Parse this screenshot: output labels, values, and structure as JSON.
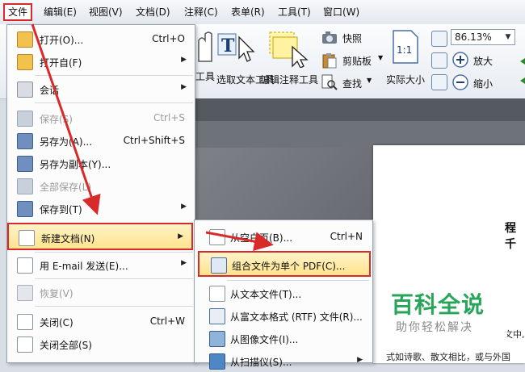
{
  "menubar": {
    "items": [
      {
        "label": "文件",
        "active": true
      },
      {
        "label": "编辑(E)"
      },
      {
        "label": "视图(V)"
      },
      {
        "label": "文档(D)"
      },
      {
        "label": "注释(C)"
      },
      {
        "label": "表单(R)"
      },
      {
        "label": "工具(T)"
      },
      {
        "label": "窗口(W)"
      }
    ]
  },
  "ribbon": {
    "tool_partial": "工具",
    "select_text_tool": "选取文本工具",
    "edit_annotation_tool": "编辑注释工具",
    "snapshot": "快照",
    "clipboard": "剪贴板",
    "find": "查找",
    "actual_size": "实际大小",
    "zoom_value": "86.13%",
    "zoom_in": "放大",
    "zoom_out": "缩小",
    "icon_actual_size_text": "1:1"
  },
  "file_menu": {
    "open": {
      "label": "打开(O)...",
      "shortcut": "Ctrl+O"
    },
    "open_from": {
      "label": "打开自(F)"
    },
    "meeting": {
      "label": "会话"
    },
    "save": {
      "label": "保存(S)",
      "shortcut": "Ctrl+S"
    },
    "save_as": {
      "label": "另存为(A)...",
      "shortcut": "Ctrl+Shift+S"
    },
    "save_copy": {
      "label": "另存为副本(Y)..."
    },
    "save_all": {
      "label": "全部保存(L)"
    },
    "save_to": {
      "label": "保存到(T)"
    },
    "new_doc": {
      "label": "新建文档(N)"
    },
    "email": {
      "label": "用 E-mail 发送(E)..."
    },
    "revert": {
      "label": "恢复(V)"
    },
    "close": {
      "label": "关闭(C)",
      "shortcut": "Ctrl+W"
    },
    "close_all": {
      "label": "关闭全部(S)"
    }
  },
  "new_submenu": {
    "blank": {
      "label": "从空白页(B)...",
      "shortcut": "Ctrl+N"
    },
    "combine": {
      "label": "组合文件为单个 PDF(C)..."
    },
    "from_text": {
      "label": "从文本文件(T)..."
    },
    "from_rtf": {
      "label": "从富文本格式 (RTF) 文件(R)..."
    },
    "from_image": {
      "label": "从图像文件(I)..."
    },
    "from_scanner": {
      "label": "从扫描仪(S)..."
    }
  },
  "document": {
    "title_fragment": "程千",
    "text_fragment1": "文中,",
    "text_fragment2": "式如诗歌、散文相比，或与外国"
  },
  "watermark": {
    "title": "百科全说",
    "subtitle": "助你轻松解决"
  },
  "colors": {
    "highlight_border": "#d82a2a",
    "highlight_fill": "#ffe38d",
    "watermark_green": "#28a55a"
  }
}
